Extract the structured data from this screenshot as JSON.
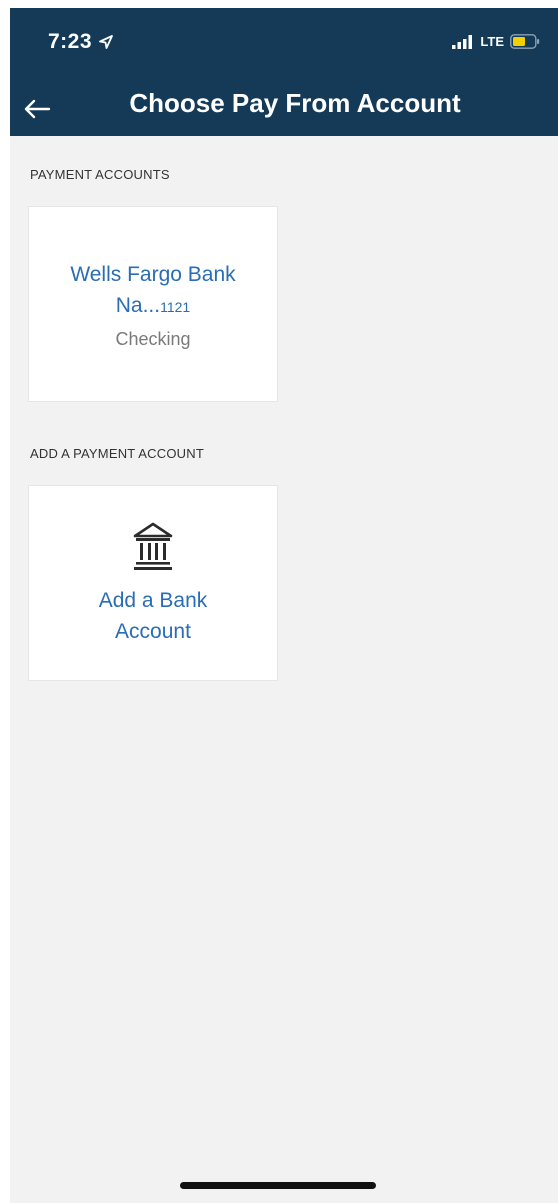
{
  "status_bar": {
    "time": "7:23",
    "network": "LTE",
    "icons": [
      "location-arrow-icon",
      "signal-bars-icon",
      "battery-icon"
    ],
    "battery_color": "#f5d000"
  },
  "header": {
    "title": "Choose Pay From Account",
    "back_icon": "back-arrow-icon",
    "background": "#143a58"
  },
  "payment_accounts": {
    "section_label": "PAYMENT ACCOUNTS",
    "accounts": [
      {
        "name_line1": "Wells Fargo Bank",
        "name_line2": "Na...",
        "last_digits": "1121",
        "type": "Checking"
      }
    ]
  },
  "add_account": {
    "section_label": "ADD A PAYMENT ACCOUNT",
    "icon": "bank-icon",
    "label_line1": "Add a Bank",
    "label_line2": "Account"
  },
  "colors": {
    "accent": "#2a6db5",
    "page_background": "#f2f2f2"
  }
}
